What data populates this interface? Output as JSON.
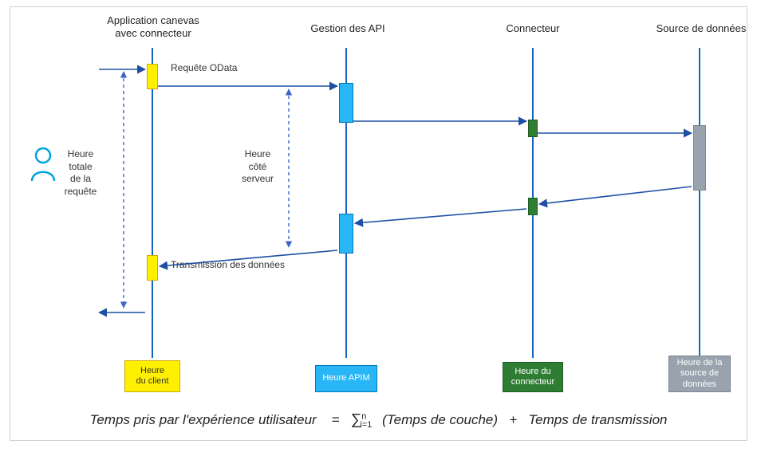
{
  "lanes": {
    "app": {
      "title": "Application canevas\navec connecteur",
      "foot": "Heure\ndu client"
    },
    "apim": {
      "title": "Gestion des API",
      "foot": "Heure APIM"
    },
    "connector": {
      "title": "Connecteur",
      "foot": "Heure du\nconnecteur"
    },
    "datasource": {
      "title": "Source de données",
      "foot": "Heure de la\nsource de\ndonnées"
    }
  },
  "messages": {
    "request": "Requête OData",
    "response": "Transmission des données"
  },
  "side_labels": {
    "total": "Heure\ntotale\nde la\nrequête",
    "server": "Heure\ncôté\nserveur"
  },
  "formula": {
    "lhs": "Temps pris par l'expérience utilisateur",
    "eq": "=",
    "sum_upper": "n",
    "sum_lower": "i=1",
    "term1": "(Temps de couche)",
    "plus": "+",
    "term2": "Temps de transmission"
  },
  "colors": {
    "arrow": "#1e4fa3",
    "dashed_span": "#3f63c9"
  }
}
